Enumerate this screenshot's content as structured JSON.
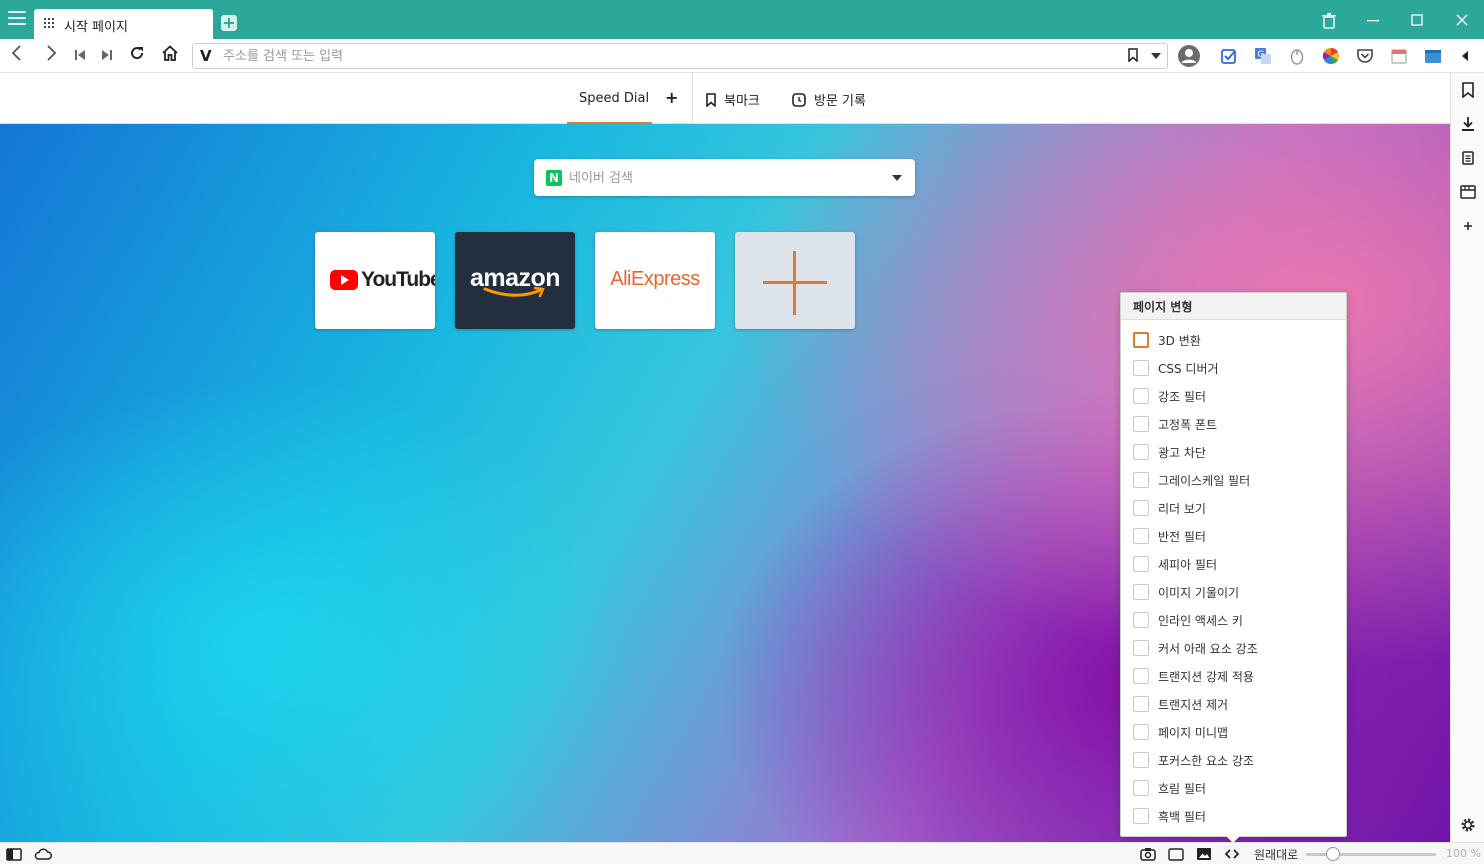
{
  "browser": {
    "tab_title": "시작 페이지",
    "address_placeholder": "주소를 검색 또는 입력"
  },
  "start_page": {
    "speed_dial_label": "Speed Dial",
    "add_label": "+",
    "bookmarks_label": "북마크",
    "history_label": "방문 기록",
    "search_placeholder": "네이버 검색",
    "search_engine_badge": "N",
    "dials": [
      {
        "title": "YouTube"
      },
      {
        "title": "amazon"
      },
      {
        "title": "AliExpress"
      }
    ]
  },
  "page_actions": {
    "title": "페이지 변형",
    "items": [
      {
        "label": "3D 변환",
        "checked": false
      },
      {
        "label": "CSS 디버거",
        "checked": false
      },
      {
        "label": "강조 필터",
        "checked": false
      },
      {
        "label": "고정폭 폰트",
        "checked": false
      },
      {
        "label": "광고 차단",
        "checked": false
      },
      {
        "label": "그레이스케일 필터",
        "checked": false
      },
      {
        "label": "리더 보기",
        "checked": false
      },
      {
        "label": "반전 필터",
        "checked": false
      },
      {
        "label": "세피아 필터",
        "checked": false
      },
      {
        "label": "이미지 기울이기",
        "checked": false
      },
      {
        "label": "인라인 액세스 키",
        "checked": false
      },
      {
        "label": "커서 아래 요소 강조",
        "checked": false
      },
      {
        "label": "트랜지션 강제 적용",
        "checked": false
      },
      {
        "label": "트랜지션 제거",
        "checked": false
      },
      {
        "label": "페이지 미니맵",
        "checked": false
      },
      {
        "label": "포커스한 요소 강조",
        "checked": false
      },
      {
        "label": "흐림 필터",
        "checked": false
      },
      {
        "label": "흑백 필터",
        "checked": false
      }
    ]
  },
  "statusbar": {
    "zoom_reset_label": "원래대로",
    "zoom_value": "100 %"
  },
  "colors": {
    "titlebar": "#2ba89a",
    "accent": "#e27a2b",
    "amazon_bg": "#232f3e",
    "youtube_red": "#ff0000",
    "aliexpress_orange": "#e8652b",
    "naver_green": "#03c75a"
  }
}
